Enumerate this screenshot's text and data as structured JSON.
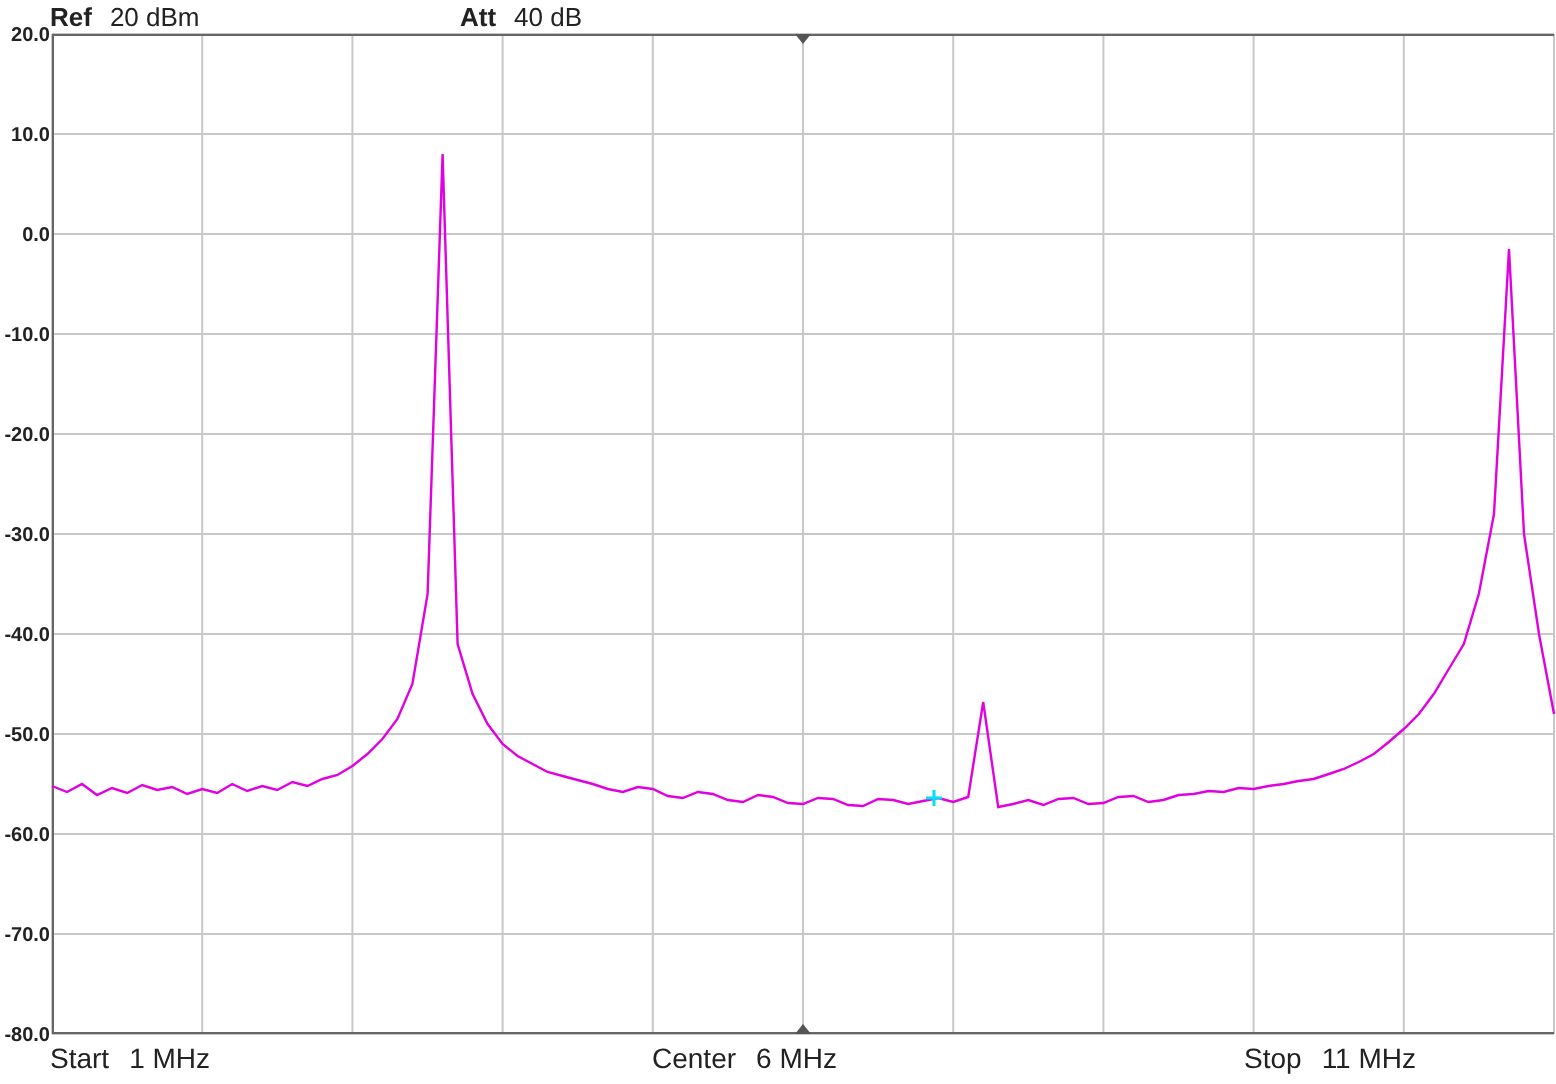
{
  "header": [
    {
      "label": "Ref",
      "value": "20 dBm"
    },
    {
      "label": "Att",
      "value": "40 dB"
    }
  ],
  "chart_data": {
    "type": "line",
    "grid": true,
    "ylim": [
      -80,
      20
    ],
    "yticks": [
      {
        "value": 20,
        "label": "20.0"
      },
      {
        "value": 10,
        "label": "10.0"
      },
      {
        "value": 0,
        "label": "0.0"
      },
      {
        "value": -10,
        "label": "-10.0"
      },
      {
        "value": -20,
        "label": "-20.0"
      },
      {
        "value": -30,
        "label": "-30.0"
      },
      {
        "value": -40,
        "label": "-40.0"
      },
      {
        "value": -50,
        "label": "-50.0"
      },
      {
        "value": -60,
        "label": "-60.0"
      },
      {
        "value": -70,
        "label": "-70.0"
      },
      {
        "value": -80,
        "label": "-80.0"
      }
    ],
    "categories": [
      null,
      null,
      null,
      null,
      null,
      null,
      null,
      null,
      null,
      null,
      null,
      null,
      null,
      null,
      null,
      null,
      null,
      null,
      null,
      null,
      null,
      null,
      null,
      null,
      null,
      null,
      null,
      null,
      null,
      null,
      null,
      null,
      null,
      null,
      null,
      null,
      null,
      null,
      null,
      null,
      null,
      null,
      null,
      null,
      null,
      null,
      null,
      null,
      null,
      null,
      null,
      null,
      null,
      null,
      null,
      null,
      null,
      null,
      null,
      null,
      null,
      null,
      null,
      null,
      null,
      null,
      null,
      null,
      null,
      null,
      null,
      null,
      null,
      null,
      null,
      null,
      null,
      null,
      null,
      null,
      null,
      null,
      null,
      null,
      null,
      null,
      null,
      null,
      null,
      null,
      null,
      null,
      null,
      null,
      null,
      null,
      null,
      null,
      null,
      null,
      null
    ],
    "series": [
      {
        "color": "#e000e0",
        "values": [
          -55.2,
          -55.8,
          -55.0,
          -56.1,
          -55.4,
          -55.9,
          -55.1,
          -55.6,
          -55.3,
          -56.0,
          -55.5,
          -55.9,
          -55.0,
          -55.7,
          -55.2,
          -55.6,
          -54.8,
          -55.2,
          -54.5,
          -54.1,
          -53.2,
          -52.0,
          -50.5,
          -48.5,
          -45.0,
          -36.0,
          8.0,
          -41.0,
          -46.0,
          -49.0,
          -51.0,
          -52.2,
          -53.0,
          -53.8,
          -54.2,
          -54.6,
          -55.0,
          -55.5,
          -55.8,
          -55.3,
          -55.5,
          -56.2,
          -56.4,
          -55.8,
          -56.0,
          -56.6,
          -56.8,
          -56.1,
          -56.3,
          -56.9,
          -57.0,
          -56.4,
          -56.5,
          -57.1,
          -57.2,
          -56.5,
          -56.6,
          -57.0,
          -56.7,
          -56.4,
          -56.8,
          -56.3,
          -46.8,
          -57.3,
          -57.0,
          -56.6,
          -57.1,
          -56.5,
          -56.4,
          -57.0,
          -56.9,
          -56.3,
          -56.2,
          -56.8,
          -56.6,
          -56.1,
          -56.0,
          -55.7,
          -55.8,
          -55.4,
          -55.5,
          -55.2,
          -55.0,
          -54.7,
          -54.5,
          -54.0,
          -53.5,
          -52.8,
          -52.0,
          -50.8,
          -49.5,
          -48.0,
          -46.0,
          -43.5,
          -41.0,
          -36.0,
          -28.0,
          -1.5,
          -30.0,
          -40.0,
          -48.0
        ]
      }
    ]
  },
  "footer": [
    {
      "label": "Start",
      "value": "1 MHz"
    },
    {
      "label": "Center",
      "value": "6 MHz"
    },
    {
      "label": "Stop",
      "value": "11 MHz"
    }
  ]
}
